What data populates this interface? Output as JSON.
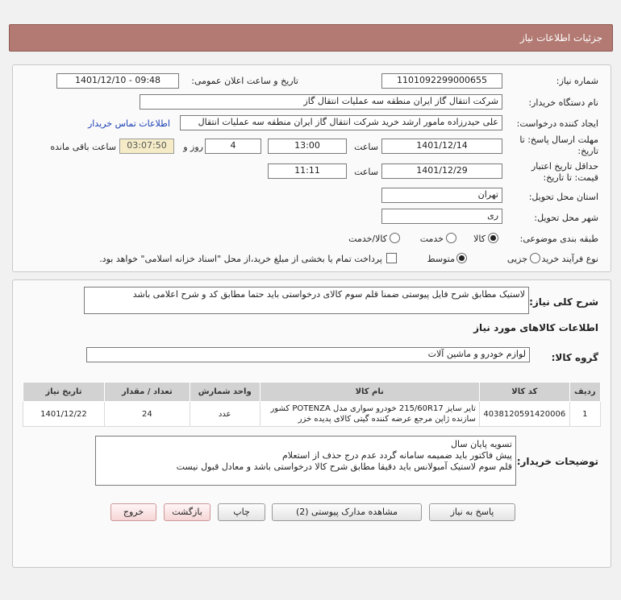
{
  "header": {
    "title": "جزئیات اطلاعات نیاز"
  },
  "form": {
    "need_number": {
      "label": "شماره نیاز:",
      "value": "1101092299000655"
    },
    "announce": {
      "label": "تاریخ و ساعت اعلان عمومی:",
      "value": "1401/12/10 - 09:48"
    },
    "buyer_org": {
      "label": "نام دستگاه خریدار:",
      "value": "شرکت انتقال گاز ایران منطقه سه عملیات انتقال گاز"
    },
    "requester": {
      "label": "ایجاد کننده درخواست:",
      "value": "علی حیدرزاده مامور ارشد خرید شرکت انتقال گاز ایران منطقه سه عملیات انتقال",
      "contact_link": "اطلاعات تماس خریدار"
    },
    "deadline": {
      "label_line1": "مهلت ارسال پاسخ: تا",
      "label_line2": "تاریخ:",
      "date": "1401/12/14",
      "time_label": "ساعت",
      "time": "13:00",
      "days": "4",
      "days_label": "روز و",
      "remaining": "03:07:50",
      "remaining_label": "ساعت باقی مانده"
    },
    "validity": {
      "label_line1": "حداقل تاریخ اعتبار",
      "label_line2": "قیمت: تا تاریخ:",
      "date": "1401/12/29",
      "time_label": "ساعت",
      "time": "11:11"
    },
    "province": {
      "label": "استان محل تحویل:",
      "value": "تهران"
    },
    "city": {
      "label": "شهر محل تحویل:",
      "value": "ری"
    },
    "category": {
      "label": "طبقه بندی موضوعی:",
      "options": [
        "کالا",
        "خدمت",
        "کالا/خدمت"
      ],
      "selected": "کالا"
    },
    "process": {
      "label": "نوع فرآیند خرید :",
      "options": [
        "جزیی",
        "متوسط"
      ],
      "selected": "متوسط",
      "payment_note": "پرداخت تمام یا بخشی از مبلغ خرید،از محل \"اسناد خزانه اسلامی\" خواهد بود."
    }
  },
  "details": {
    "summary_label": "شرح کلی نیاز:",
    "summary": "لاستیک مطابق شرح فایل پیوستی ضمنا قلم سوم کالای درخواستی باید حتما مطابق کد و شرح اعلامی باشد",
    "goods_info_title": "اطلاعات کالاهای مورد نیاز",
    "goods_group_label": "گروه کالا:",
    "goods_group": "لوازم خودرو و ماشین آلات",
    "table": {
      "headers": [
        "ردیف",
        "کد کالا",
        "نام کالا",
        "واحد شمارش",
        "تعداد / مقدار",
        "تاریخ نیاز"
      ],
      "rows": [
        [
          "1",
          "4038120591420006",
          "تایر سایز 215/60R17 خودرو سواری مدل POTENZA کشور سازنده ژاپن مرجع عرضه کننده گیتی کالای پدیده خزر",
          "عدد",
          "24",
          "1401/12/22"
        ]
      ]
    },
    "buyer_notes_label": "توضیحات خریدار:",
    "buyer_notes": [
      "تسویه پایان سال",
      "پیش فاکتور باید ضمیمه سامانه گردد عدم درج حذف از استعلام",
      "قلم سوم لاستیک آمبولانس باید دقیقا مطابق شرح کالا درخواستی باشد و معادل قبول نیست"
    ]
  },
  "buttons": {
    "respond": "پاسخ به نیاز",
    "attachments": "مشاهده مدارک پیوستی (2)",
    "print": "چاپ",
    "back": "بازگشت",
    "exit": "خروج"
  },
  "colors": {
    "header_bg": "#b27a72",
    "link": "#1a3fb4",
    "remaining_bg": "#f5ecc7"
  }
}
